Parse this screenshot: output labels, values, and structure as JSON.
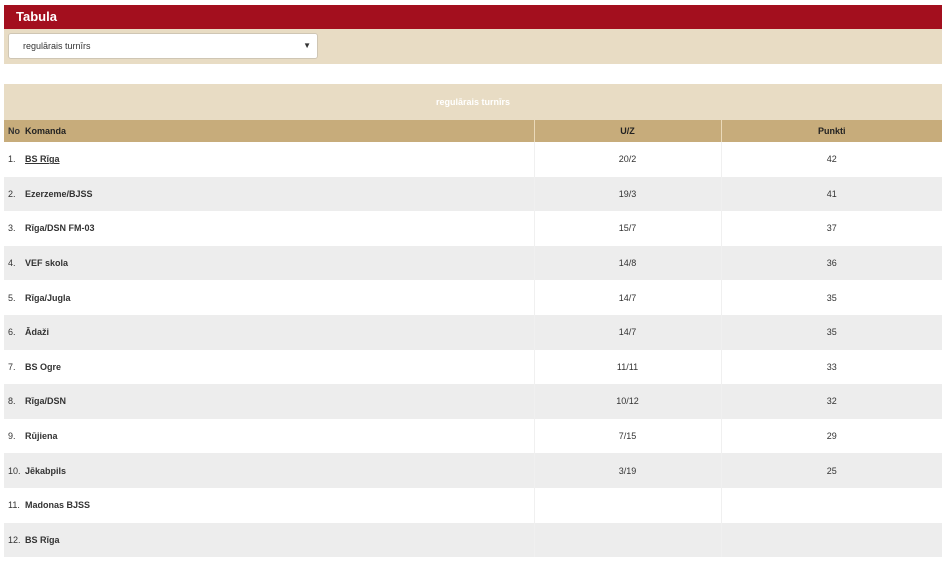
{
  "header": {
    "title": "Tabula"
  },
  "filter": {
    "selected": "regulārais turnīrs",
    "arrow_icon": "chevron-down-icon"
  },
  "table": {
    "caption": "regulārais turnīrs",
    "columns": {
      "no": "No",
      "komanda": "Komanda",
      "uz": "U/Z",
      "punkti": "Punkti"
    },
    "rows": [
      {
        "no": "1.",
        "team": "BS Rīga",
        "uz": "20/2",
        "points": "42"
      },
      {
        "no": "2.",
        "team": "Ezerzeme/BJSS",
        "uz": "19/3",
        "points": "41"
      },
      {
        "no": "3.",
        "team": "Rīga/DSN FM-03",
        "uz": "15/7",
        "points": "37"
      },
      {
        "no": "4.",
        "team": "VEF skola",
        "uz": "14/8",
        "points": "36"
      },
      {
        "no": "5.",
        "team": "Rīga/Jugla",
        "uz": "14/7",
        "points": "35"
      },
      {
        "no": "6.",
        "team": "Ādaži",
        "uz": "14/7",
        "points": "35"
      },
      {
        "no": "7.",
        "team": "BS Ogre",
        "uz": "11/11",
        "points": "33"
      },
      {
        "no": "8.",
        "team": "Rīga/DSN",
        "uz": "10/12",
        "points": "32"
      },
      {
        "no": "9.",
        "team": "Rūjiena",
        "uz": "7/15",
        "points": "29"
      },
      {
        "no": "10.",
        "team": "Jēkabpils",
        "uz": "3/19",
        "points": "25"
      },
      {
        "no": "11.",
        "team": "Madonas BJSS",
        "uz": "",
        "points": ""
      },
      {
        "no": "12.",
        "team": "BS Rīga",
        "uz": "",
        "points": ""
      }
    ]
  },
  "colors": {
    "header_bg": "#a30f1e",
    "filter_bg": "#e8dcc4",
    "table_head_bg": "#c7ac7b",
    "row_alt_bg": "#ededed"
  }
}
